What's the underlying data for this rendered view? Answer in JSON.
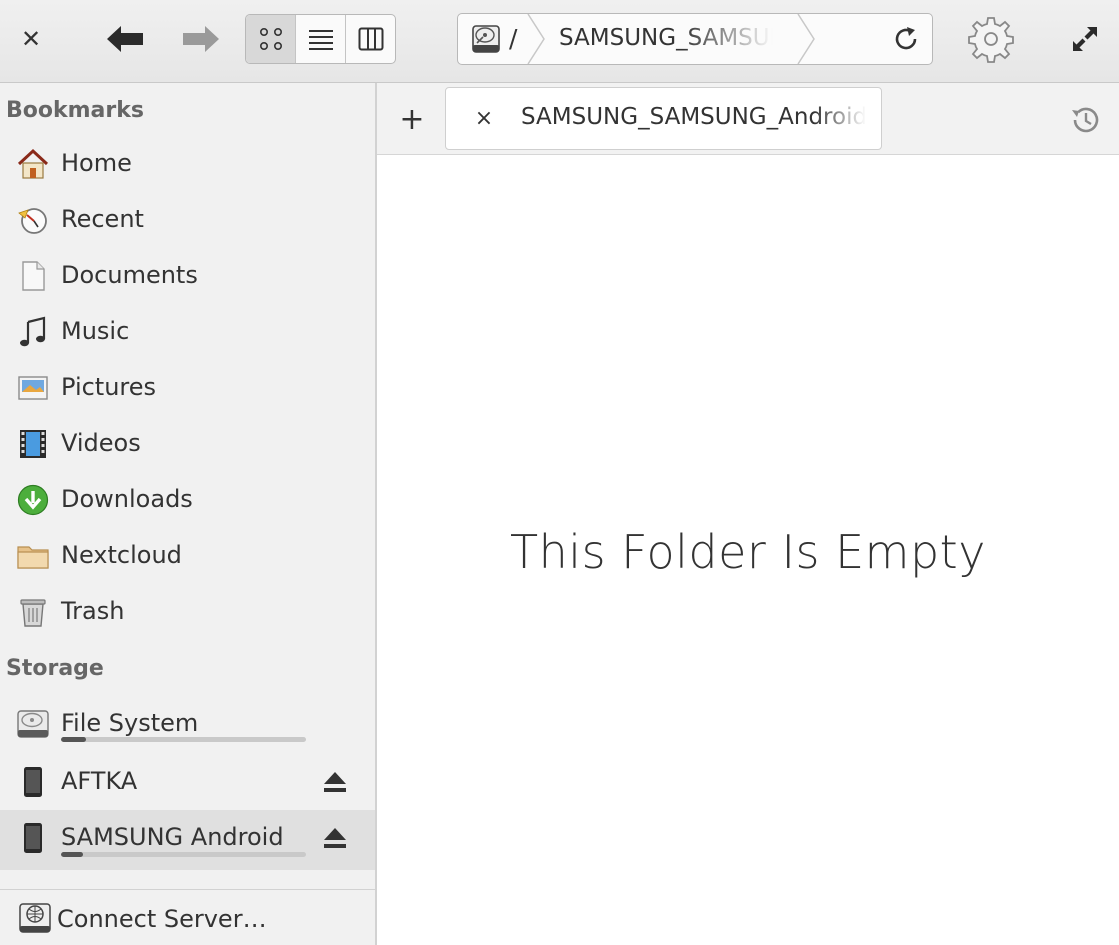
{
  "window": {
    "close_icon": "close-icon",
    "maximize_icon": "maximize-icon"
  },
  "toolbar": {
    "back_icon": "back-arrow-icon",
    "forward_icon": "forward-arrow-icon",
    "view_modes": [
      "icon-view",
      "list-view",
      "column-view"
    ],
    "active_view": "icon-view",
    "settings_icon": "gear-icon"
  },
  "location": {
    "root": "/",
    "crumb": "SAMSUNG_SAMSUNG_Android",
    "reload_icon": "reload-icon"
  },
  "sidebar": {
    "bookmarks_header": "Bookmarks",
    "bookmarks": [
      {
        "label": "Home",
        "icon": "home-icon"
      },
      {
        "label": "Recent",
        "icon": "recent-icon"
      },
      {
        "label": "Documents",
        "icon": "documents-icon"
      },
      {
        "label": "Music",
        "icon": "music-icon"
      },
      {
        "label": "Pictures",
        "icon": "pictures-icon"
      },
      {
        "label": "Videos",
        "icon": "videos-icon"
      },
      {
        "label": "Downloads",
        "icon": "downloads-icon"
      },
      {
        "label": "Nextcloud",
        "icon": "folder-icon"
      },
      {
        "label": "Trash",
        "icon": "trash-icon"
      }
    ],
    "storage_header": "Storage",
    "storage": [
      {
        "label": "File System",
        "icon": "harddisk-icon",
        "usage": 0.1,
        "eject": false,
        "selected": false
      },
      {
        "label": "AFTKA",
        "icon": "phone-icon",
        "eject": true,
        "selected": false
      },
      {
        "label": "SAMSUNG Android",
        "icon": "phone-icon",
        "usage": 0.09,
        "eject": true,
        "selected": true
      }
    ],
    "connect_server": "Connect Server…"
  },
  "tabs": {
    "new_tab_label": "+",
    "items": [
      {
        "label": "SAMSUNG_SAMSUNG_Android",
        "close_label": "×"
      }
    ],
    "history_icon": "history-icon"
  },
  "content": {
    "empty_message": "This Folder Is Empty"
  }
}
